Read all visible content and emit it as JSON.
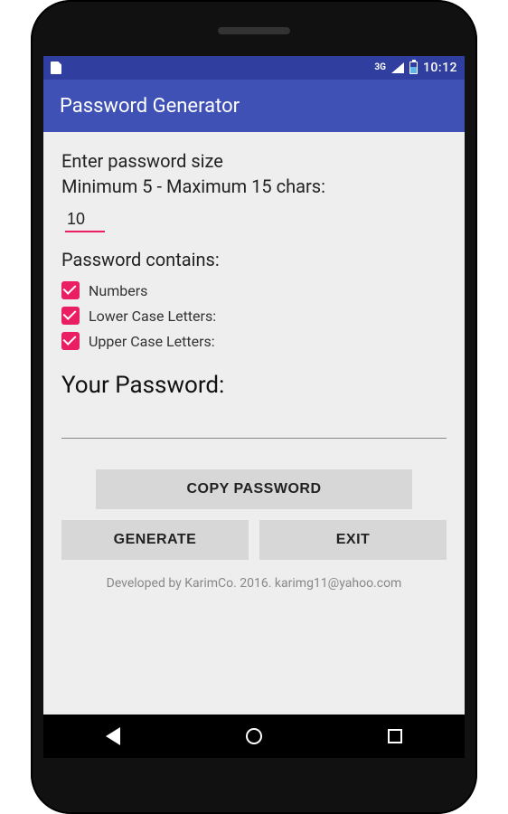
{
  "status": {
    "network": "3G",
    "clock": "10:12"
  },
  "appbar": {
    "title": "Password Generator"
  },
  "size": {
    "label_line1": "Enter password size",
    "label_line2": "Minimum 5 - Maximum 15 chars:",
    "value": "10"
  },
  "contains": {
    "heading": "Password contains:",
    "options": [
      {
        "label": "Numbers",
        "checked": true
      },
      {
        "label": "Lower Case Letters:",
        "checked": true
      },
      {
        "label": "Upper Case Letters:",
        "checked": true
      }
    ]
  },
  "output": {
    "heading": "Your Password:",
    "value": ""
  },
  "buttons": {
    "copy": "COPY PASSWORD",
    "generate": "GENERATE",
    "exit": "EXIT"
  },
  "footer": "Developed by KarimCo. 2016. karimg11@yahoo.com"
}
